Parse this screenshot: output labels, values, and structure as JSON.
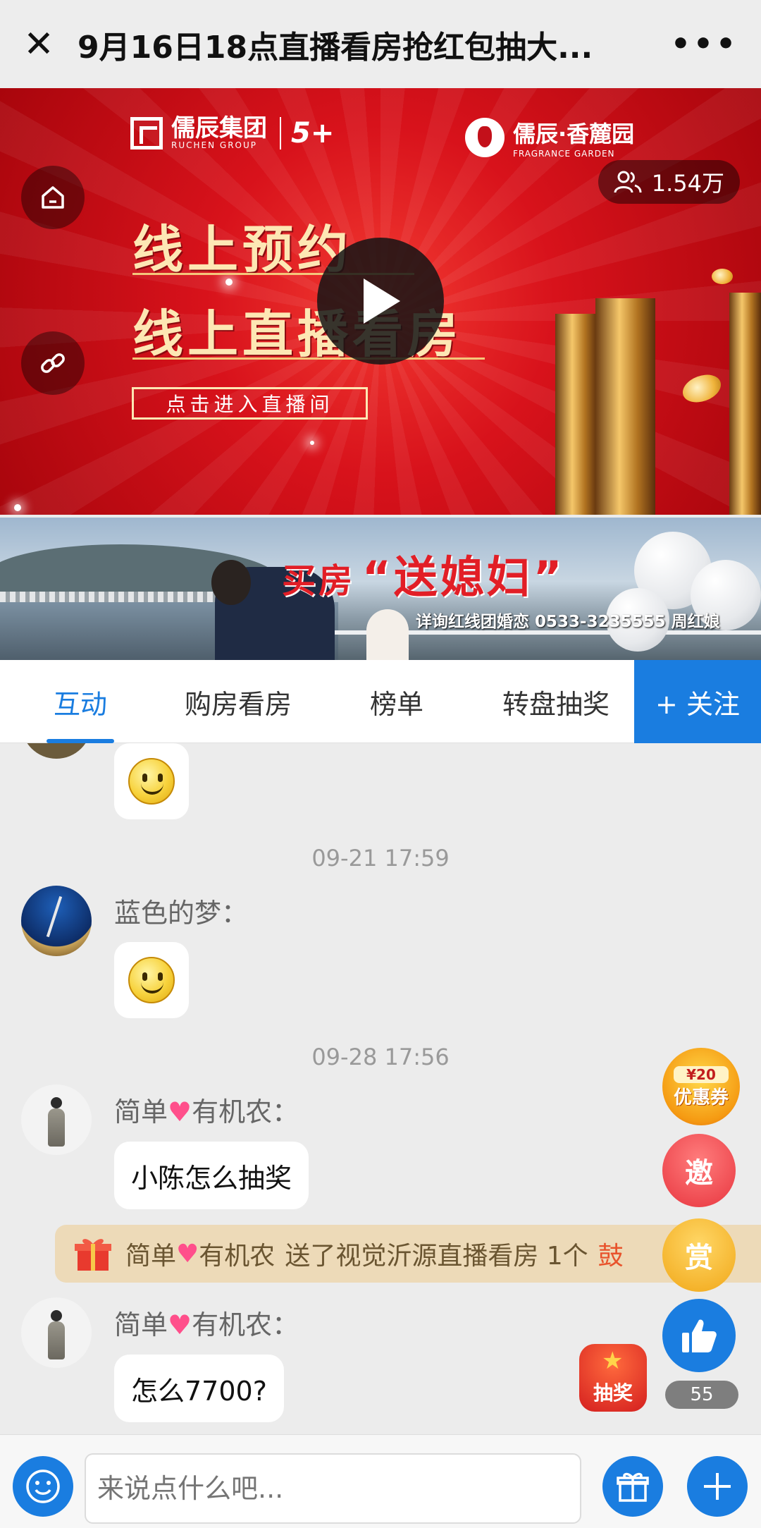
{
  "titlebar": {
    "title": "9月16日18点直播看房抢红包抽大...",
    "close_icon": "close-icon",
    "more_label": "•••"
  },
  "banner": {
    "brand_left": "儒辰集团",
    "brand_left_en": "RUCHEN GROUP",
    "brand_plus": "5+",
    "brand_right": "儒辰·香麓园",
    "brand_right_en": "FRAGRANCE GARDEN",
    "viewers": "1.54万",
    "headline1": "线上预约",
    "headline2": "线上直播看房",
    "enter_label": "点击进入直播间",
    "accent_color": "#d8121b"
  },
  "ad": {
    "buy": "买房",
    "headline": "“送媳妇”",
    "contact": "详询红线团婚恋  0533-3235555 周红娘"
  },
  "tabs": [
    {
      "label": "互动",
      "active": true
    },
    {
      "label": "购房看房",
      "active": false
    },
    {
      "label": "榜单",
      "active": false
    },
    {
      "label": "转盘抽奖",
      "active": false
    }
  ],
  "follow_label": "+ 关注",
  "chat": {
    "time1": "09-21 17:59",
    "user1": "蓝色的梦：",
    "time2": "09-28 17:56",
    "user2_a": "简单",
    "user2_b": "有机农：",
    "msg2": "小陈怎么抽奖",
    "gift_user_a": "简单",
    "gift_user_b": "有机农",
    "gift_text": "送了视觉沂源直播看房 1个",
    "gift_tail": "鼓",
    "msg3": "怎么7700?"
  },
  "floating": {
    "coupon_top": "¥20",
    "coupon_label": "优惠券",
    "invite_label": "邀",
    "reward_label": "赏",
    "lottery_label": "抽奖",
    "like_count": "55"
  },
  "bottombar": {
    "placeholder": "来说点什么吧..."
  },
  "colors": {
    "primary": "#1a7de0",
    "gift_bg": "#eddab8"
  }
}
